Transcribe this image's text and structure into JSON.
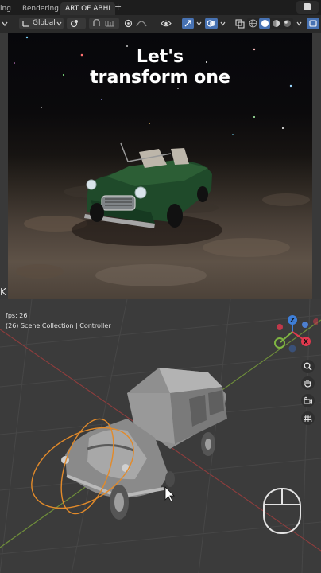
{
  "tabs": {
    "items": [
      "ing",
      "Rendering",
      "ART OF ABHI"
    ],
    "active": "ART OF ABHI",
    "add_symbol": "+"
  },
  "header": {
    "transform_orientation": "Global"
  },
  "render_preview": {
    "caption_line1": "Let's",
    "caption_line2": "transform one"
  },
  "viewport": {
    "fps_text": "fps: 26",
    "scene_info": "(26) Scene Collection | Controller",
    "side_letter": "K",
    "gizmo_axes": {
      "x": "X",
      "y": "Y",
      "z": "Z"
    }
  },
  "icons": [
    "cursor-icon",
    "transform-orientation-icon",
    "pivot-icon",
    "snap-icon",
    "proportional-edit-icon",
    "visibility-icon",
    "gizmo-icon",
    "overlay-icon",
    "xray-icon",
    "shading-wireframe-icon",
    "shading-solid-icon",
    "shading-material-icon",
    "shading-rendered-icon",
    "zoom-icon",
    "hand-pan-icon",
    "camera-icon",
    "grid-icon",
    "mouse-icon"
  ],
  "colors": {
    "x_axis": "#e2394e",
    "y_axis": "#7fb542",
    "z_axis": "#3e7fd9",
    "selection_orange": "#e28a2a",
    "active_tab_bg": "#303030"
  }
}
